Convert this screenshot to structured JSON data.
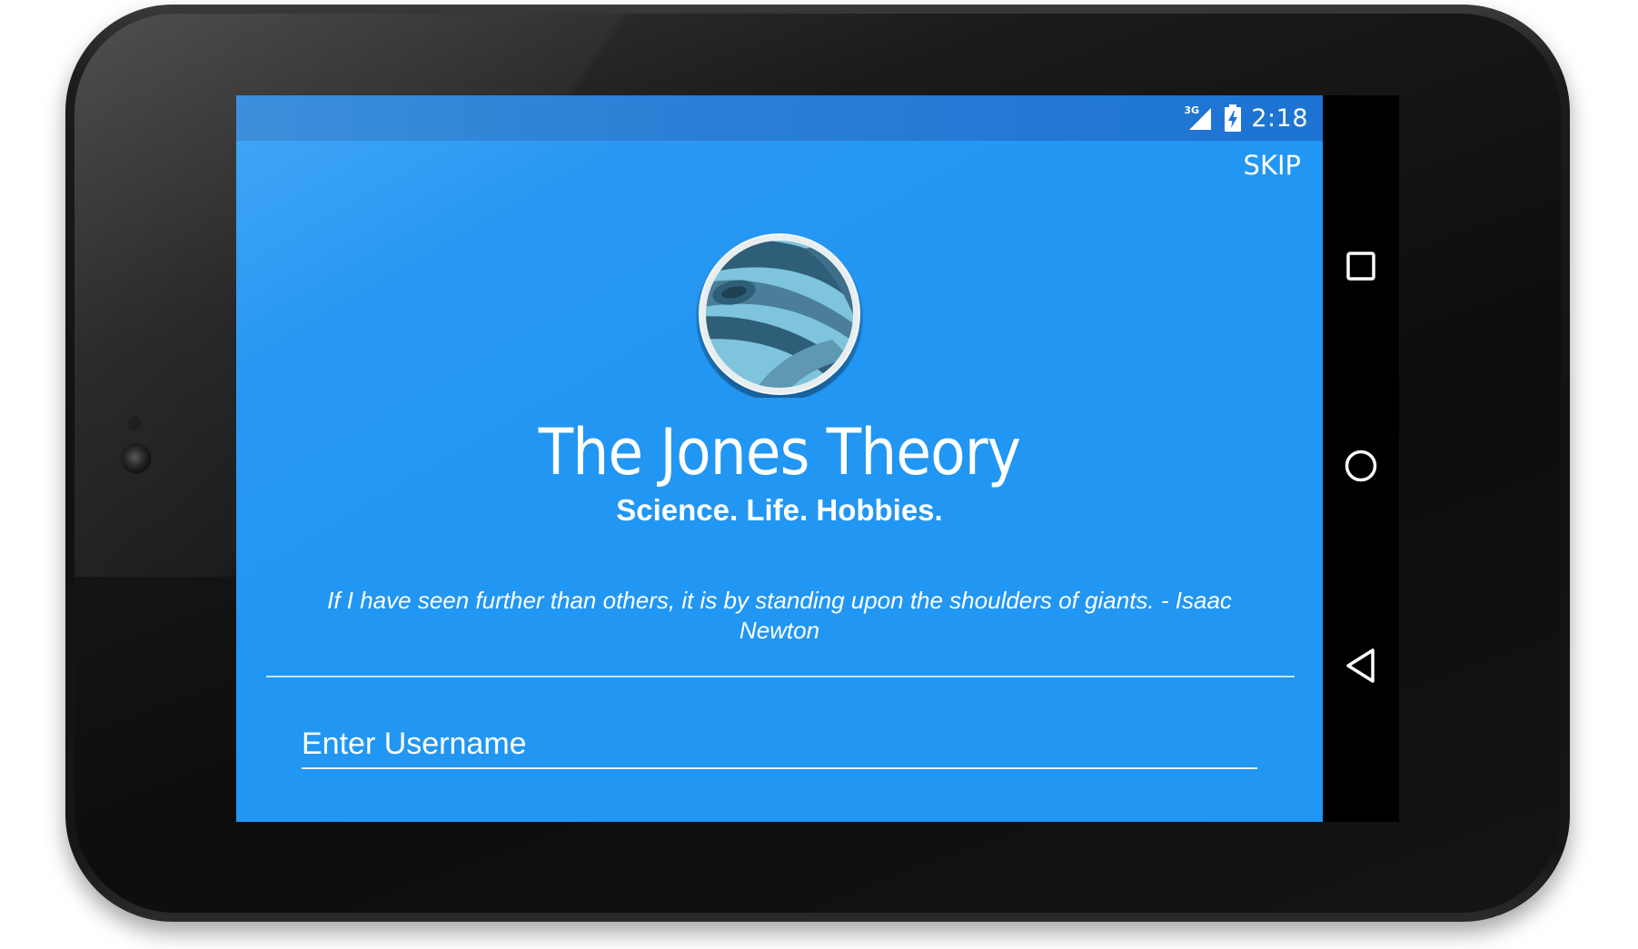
{
  "status_bar": {
    "network_label": "3G",
    "time": "2:18",
    "icons": [
      "signal-icon",
      "battery-charging-icon"
    ]
  },
  "header": {
    "skip_label": "SKIP"
  },
  "main": {
    "logo_icon": "planet-logo-icon",
    "title": "The Jones Theory",
    "subtitle": "Science. Life. Hobbies.",
    "quote": "If I have seen further than others, it is by standing upon the shoulders of giants. - Isaac Newton"
  },
  "form": {
    "username_placeholder": "Enter Username",
    "username_value": ""
  },
  "nav_bar": {
    "buttons": [
      "recents-icon",
      "home-icon",
      "back-icon"
    ]
  },
  "colors": {
    "app_background": "#2196f3",
    "status_bar": "#1c73d2",
    "nav_bar": "#000000",
    "text": "#ffffff",
    "logo_light": "#7ec4dc",
    "logo_dark": "#2f5e78"
  }
}
